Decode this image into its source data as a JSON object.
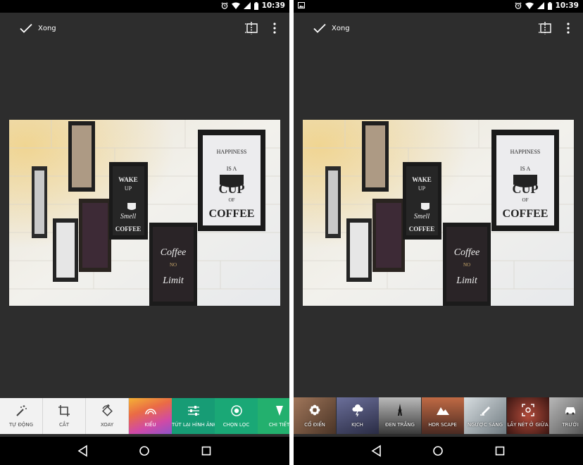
{
  "status_bar": {
    "time": "10:39"
  },
  "app_bar": {
    "done_label": "Xong"
  },
  "left_toolbar": [
    {
      "label": "TỰ ĐỘNG",
      "icon": "magic-wand-icon",
      "color": "#f2f2f2"
    },
    {
      "label": "CẮT",
      "icon": "crop-icon",
      "color": "#f2f2f2"
    },
    {
      "label": "XOAY",
      "icon": "rotate-icon",
      "color": "#f2f2f2"
    },
    {
      "label": "KIỂU",
      "icon": "rainbow-icon",
      "color": "#e8a23a"
    },
    {
      "label": "TÚT LẠI HÌNH ẢNH",
      "icon": "sliders-icon",
      "color": "#179c75"
    },
    {
      "label": "CHỌN LỌC",
      "icon": "target-icon",
      "color": "#1aa876"
    },
    {
      "label": "CHI TIẾT",
      "icon": "triangle-down-icon",
      "color": "#23b06e"
    }
  ],
  "right_filters": [
    {
      "label": "CỔ ĐIỂN",
      "icon": "flower-icon",
      "color": "#6b4f3a"
    },
    {
      "label": "KỊCH",
      "icon": "cloud-storm-icon",
      "color": "#3a3d5c"
    },
    {
      "label": "ĐEN TRẮNG",
      "icon": "eiffel-tower-icon",
      "color": "#707070"
    },
    {
      "label": "HDR SCAPE",
      "icon": "mountain-icon",
      "color": "#8a4b36"
    },
    {
      "label": "NGƯỢC SÁNG",
      "icon": "backlight-icon",
      "color": "#9aa2a8"
    },
    {
      "label": "LẤY NÉT Ở GIỮA",
      "icon": "focus-frame-icon",
      "color": "#6a2a22"
    },
    {
      "label": "TRƯỚI",
      "icon": "car-icon",
      "color": "#8a8a8a"
    }
  ],
  "photo": {
    "posters": [
      {
        "lines": [
          "HAPPINESS",
          "IS A",
          "CUP",
          "OF",
          "COFFEE"
        ]
      },
      {
        "lines": [
          "WAKE",
          "UP",
          "Smell",
          "COFFEE"
        ]
      },
      {
        "lines": [
          "Coffee",
          "NO",
          "Limit"
        ]
      }
    ]
  }
}
